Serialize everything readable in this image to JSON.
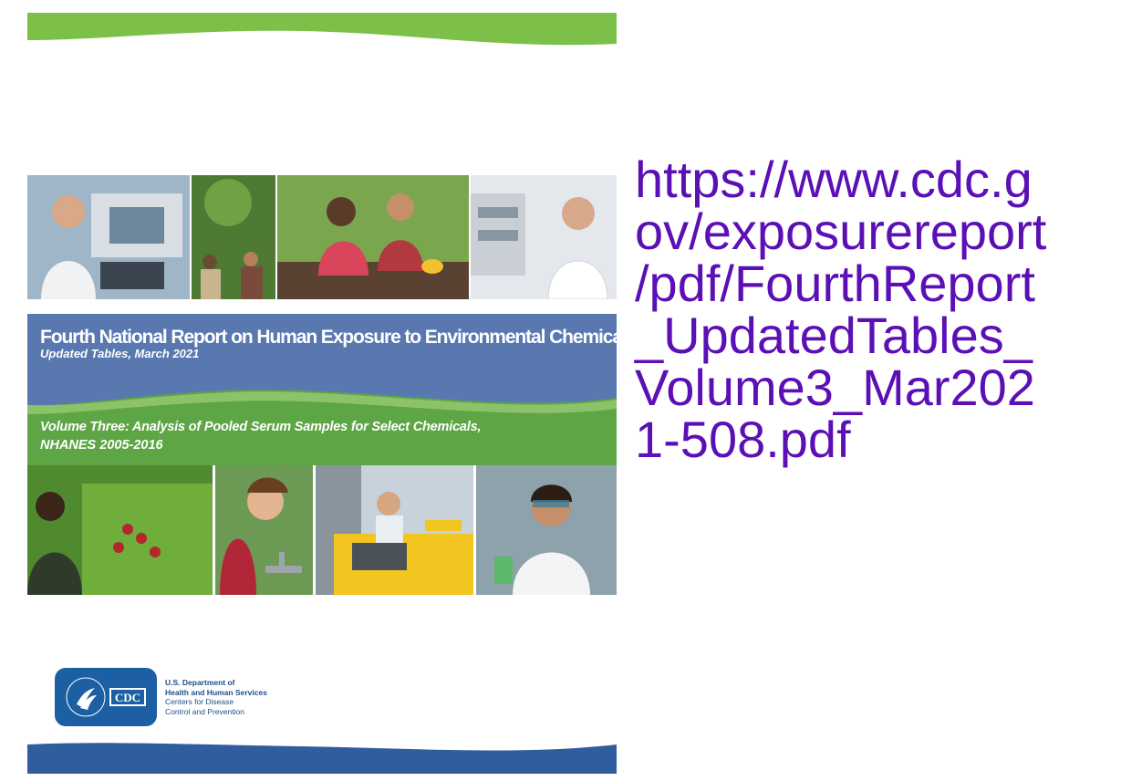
{
  "cover": {
    "title": "Fourth National Report on Human Exposure to Environmental Chemicals",
    "subtitle": "Updated Tables, March 2021",
    "volume_line1": "Volume Three: Analysis of Pooled Serum Samples for Select Chemicals,",
    "volume_line2": "NHANES 2005-2016",
    "logo_text": "CDC",
    "department": {
      "line1": "U.S. Department of",
      "line2": "Health and Human Services",
      "line3": "Centers for Disease",
      "line4": "Control and Prevention"
    },
    "photo_subjects_top": [
      "lab-technician-photo",
      "farm-workers-photo",
      "children-gardening-photo",
      "lab-scientist-photo"
    ],
    "photo_subjects_bottom": [
      "produce-shopper-photo",
      "boy-drinking-fountain-photo",
      "taxi-driver-photo",
      "lab-researcher-photo"
    ],
    "colors": {
      "blue_band": "#5a78b0",
      "green_band": "#5da545",
      "top_wave": "#7cc04a",
      "bottom_wave": "#2f5d9e",
      "logo": "#1d5fa3"
    }
  },
  "link": {
    "lines": [
      "https://www.cdc.g",
      "ov/exposurereport",
      "/pdf/FourthReport",
      "_UpdatedTables_",
      "Volume3_Mar202",
      "1-508.pdf"
    ],
    "color": "#5b0fb5"
  }
}
